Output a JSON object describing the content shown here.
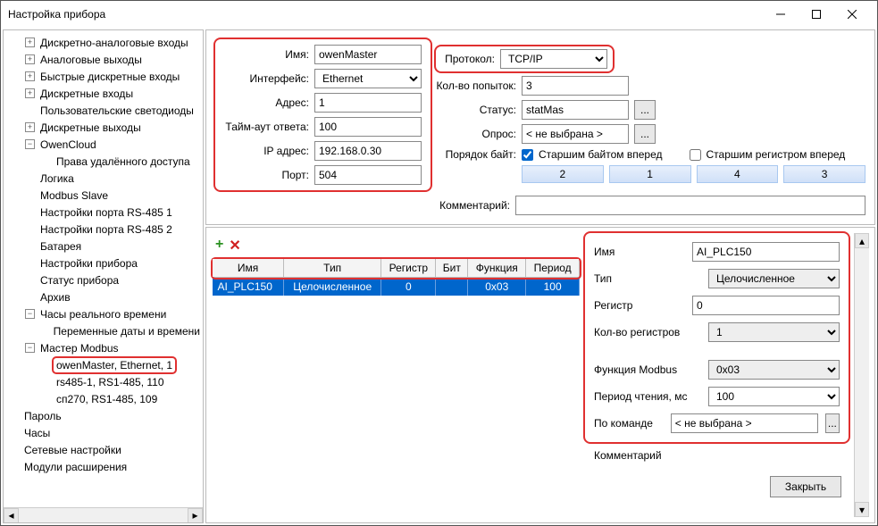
{
  "window": {
    "title": "Настройка прибора"
  },
  "tree": {
    "items": [
      {
        "ind": 1,
        "exp": "+",
        "label": "Дискретно-аналоговые входы"
      },
      {
        "ind": 1,
        "exp": "+",
        "label": "Аналоговые выходы"
      },
      {
        "ind": 1,
        "exp": "+",
        "label": "Быстрые дискретные входы"
      },
      {
        "ind": 1,
        "exp": "+",
        "label": "Дискретные входы"
      },
      {
        "ind": 1,
        "exp": "",
        "label": "Пользовательские светодиоды"
      },
      {
        "ind": 1,
        "exp": "+",
        "label": "Дискретные выходы"
      },
      {
        "ind": 1,
        "exp": "-",
        "label": "OwenCloud"
      },
      {
        "ind": 2,
        "exp": "",
        "label": "Права удалённого доступа"
      },
      {
        "ind": 1,
        "exp": "",
        "label": "Логика"
      },
      {
        "ind": 1,
        "exp": "",
        "label": "Modbus Slave"
      },
      {
        "ind": 1,
        "exp": "",
        "label": "Настройки порта RS-485 1"
      },
      {
        "ind": 1,
        "exp": "",
        "label": "Настройки порта RS-485 2"
      },
      {
        "ind": 1,
        "exp": "",
        "label": "Батарея"
      },
      {
        "ind": 1,
        "exp": "",
        "label": "Настройки прибора"
      },
      {
        "ind": 1,
        "exp": "",
        "label": "Статус прибора"
      },
      {
        "ind": 1,
        "exp": "",
        "label": "Архив"
      },
      {
        "ind": 1,
        "exp": "-",
        "label": "Часы реального времени"
      },
      {
        "ind": 2,
        "exp": "",
        "label": "Переменные даты и времени"
      },
      {
        "ind": 1,
        "exp": "-",
        "label": "Мастер Modbus"
      },
      {
        "ind": 2,
        "exp": "",
        "label": "owenMaster, Ethernet, 1",
        "sel": true
      },
      {
        "ind": 2,
        "exp": "",
        "label": "rs485-1, RS1-485, 110"
      },
      {
        "ind": 2,
        "exp": "",
        "label": "сп270, RS1-485, 109"
      },
      {
        "ind": 0,
        "exp": "",
        "label": "Пароль"
      },
      {
        "ind": 0,
        "exp": "",
        "label": "Часы"
      },
      {
        "ind": 0,
        "exp": "",
        "label": "Сетевые настройки"
      },
      {
        "ind": 0,
        "exp": "",
        "label": "Модули расширения"
      }
    ]
  },
  "form": {
    "name_lbl": "Имя:",
    "name_val": "owenMaster",
    "iface_lbl": "Интерфейс:",
    "iface_val": "Ethernet",
    "addr_lbl": "Адрес:",
    "addr_val": "1",
    "timeout_lbl": "Тайм-аут ответа:",
    "timeout_val": "100",
    "ip_lbl": "IP адрес:",
    "ip_val": "192.168.0.30",
    "port_lbl": "Порт:",
    "port_val": "504",
    "proto_lbl": "Протокол:",
    "proto_val": "TCP/IP",
    "retry_lbl": "Кол-во попыток:",
    "retry_val": "3",
    "status_lbl": "Статус:",
    "status_val": "statMas",
    "poll_lbl": "Опрос:",
    "poll_val": "< не выбрана >",
    "byteorder_lbl": "Порядок байт:",
    "cb1_lbl": "Старшим байтом вперед",
    "cb2_lbl": "Старшим регистром вперед",
    "seg": [
      "2",
      "1",
      "4",
      "3"
    ],
    "comment_lbl": "Комментарий:",
    "comment_val": "",
    "dots": "..."
  },
  "table": {
    "headers": [
      "Имя",
      "Тип",
      "Регистр",
      "Бит",
      "Функция",
      "Период"
    ],
    "row": {
      "name": "AI_PLC150",
      "type": "Целочисленное",
      "reg": "0",
      "bit": "",
      "func": "0x03",
      "period": "100"
    }
  },
  "detail": {
    "name_lbl": "Имя",
    "name_val": "AI_PLC150",
    "type_lbl": "Тип",
    "type_val": "Целочисленное",
    "reg_lbl": "Регистр",
    "reg_val": "0",
    "regcnt_lbl": "Кол-во регистров",
    "regcnt_val": "1",
    "func_lbl": "Функция Modbus",
    "func_val": "0x03",
    "period_lbl": "Период чтения, мс",
    "period_val": "100",
    "cmd_lbl": "По команде",
    "cmd_val": "< не выбрана >",
    "comment_lbl": "Комментарий",
    "dots": "..."
  },
  "footer": {
    "close": "Закрыть"
  }
}
